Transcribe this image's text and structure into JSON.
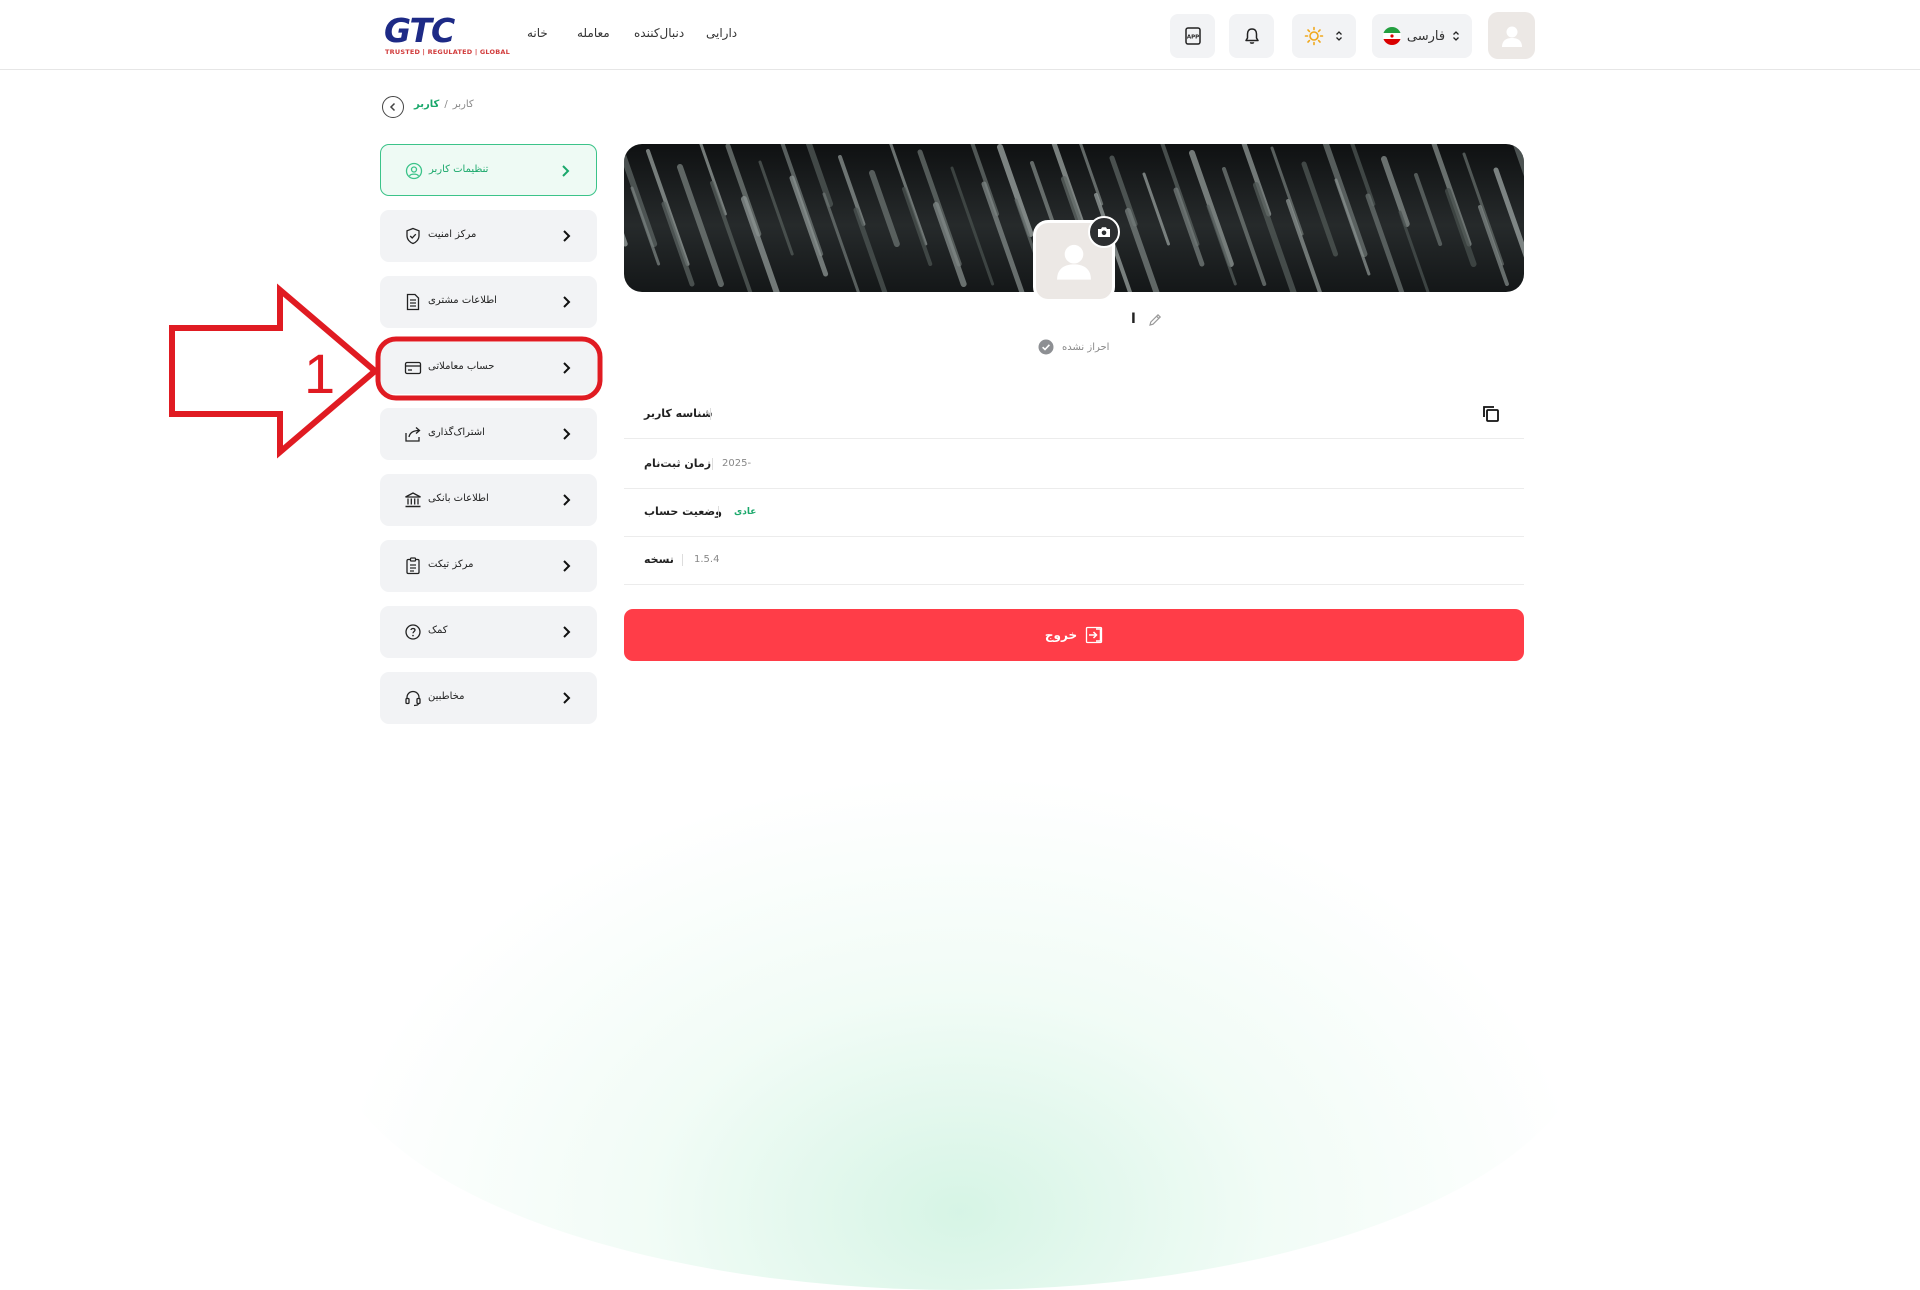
{
  "header": {
    "logo_text": "GTC",
    "logo_tagline": "TRUSTED | REGULATED | GLOBAL",
    "nav": [
      {
        "label": "خانه",
        "id": "home"
      },
      {
        "label": "معامله",
        "id": "trade"
      },
      {
        "label": "دنبال‌کننده",
        "id": "follower"
      },
      {
        "label": "دارایی",
        "id": "assets"
      }
    ],
    "language": "فارسی",
    "icons": [
      "app-download-icon",
      "bell-icon",
      "sun-icon",
      "iran-flag-icon",
      "avatar-icon"
    ]
  },
  "breadcrumb": {
    "current": "کاربر",
    "separator": "/",
    "previous": "کاربر"
  },
  "sidebar": {
    "items": [
      {
        "label": "تنظیمات کاربر",
        "icon": "user-circle-icon",
        "active": true
      },
      {
        "label": "مرکز امنیت",
        "icon": "shield-icon",
        "active": false
      },
      {
        "label": "اطلاعات مشتری",
        "icon": "document-icon",
        "active": false
      },
      {
        "label": "حساب معاملاتی",
        "icon": "card-icon",
        "active": false
      },
      {
        "label": "اشتراک‌گذاری",
        "icon": "share-icon",
        "active": false
      },
      {
        "label": "اطلاعات بانکی",
        "icon": "bank-icon",
        "active": false
      },
      {
        "label": "مرکز تیکت",
        "icon": "clipboard-icon",
        "active": false
      },
      {
        "label": "کمک",
        "icon": "help-icon",
        "active": false
      },
      {
        "label": "مخاطبین",
        "icon": "headset-icon",
        "active": false
      }
    ]
  },
  "profile": {
    "username": "ا",
    "verification": "احراز نشده"
  },
  "info_rows": [
    {
      "label": "شناسه کاربر",
      "value": ""
    },
    {
      "label": "زمان ثبت‌نام",
      "value": "2025-"
    },
    {
      "label": "وضعیت حساب",
      "value": "عادی"
    },
    {
      "label": "نسخه",
      "value": "1.5.4"
    }
  ],
  "logout_label": "خروج",
  "annotation": {
    "number": "1",
    "color": "#e01b22"
  },
  "colors": {
    "accent": "#1aa86b",
    "danger": "#ff3d48",
    "brand": "#1d2a86"
  }
}
